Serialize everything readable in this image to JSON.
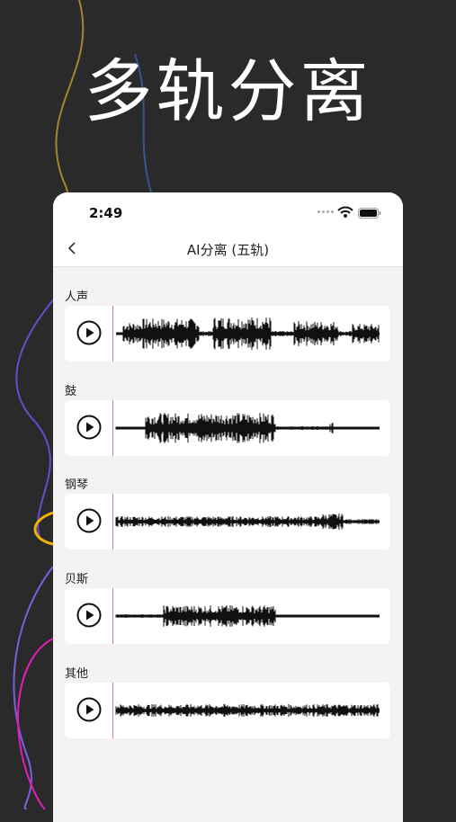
{
  "hero": {
    "title": "多轨分离"
  },
  "status": {
    "time": "2:49"
  },
  "nav": {
    "title": "AI分离 (五轨)"
  },
  "tracks": [
    {
      "label": "人声"
    },
    {
      "label": "鼓"
    },
    {
      "label": "钢琴"
    },
    {
      "label": "贝斯"
    },
    {
      "label": "其他"
    }
  ]
}
